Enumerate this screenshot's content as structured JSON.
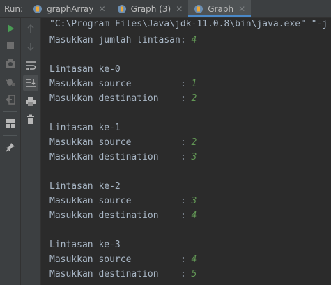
{
  "run_label": "Run:",
  "tabs": [
    {
      "label": "graphArray",
      "active": false
    },
    {
      "label": "Graph (3)",
      "active": false
    },
    {
      "label": "Graph",
      "active": true
    }
  ],
  "console": {
    "command": "\"C:\\Program Files\\Java\\jdk-11.0.8\\bin\\java.exe\" \"-j",
    "jumlah_prompt": "Masukkan jumlah lintasan: ",
    "jumlah_value": "4",
    "blocks": [
      {
        "title": "Lintasan ke-0",
        "source_prompt": "Masukkan source         : ",
        "source": "1",
        "dest_prompt": "Masukkan destination    : ",
        "dest": "2"
      },
      {
        "title": "Lintasan ke-1",
        "source_prompt": "Masukkan source         : ",
        "source": "2",
        "dest_prompt": "Masukkan destination    : ",
        "dest": "3"
      },
      {
        "title": "Lintasan ke-2",
        "source_prompt": "Masukkan source         : ",
        "source": "3",
        "dest_prompt": "Masukkan destination    : ",
        "dest": "4"
      },
      {
        "title": "Lintasan ke-3",
        "source_prompt": "Masukkan source         : ",
        "source": "4",
        "dest_prompt": "Masukkan destination    : ",
        "dest": "5"
      }
    ]
  },
  "toolbar_left": [
    "run-icon",
    "stop-icon",
    "camera-icon",
    "debug-bug-icon",
    "exit-icon",
    "layout-icon",
    "pin-icon"
  ],
  "toolbar_right": [
    "arrow-up-icon",
    "arrow-down-icon",
    "soft-wrap-icon",
    "scroll-to-end-icon",
    "print-icon",
    "trash-icon"
  ],
  "colors": {
    "background": "#2b2b2b",
    "panel": "#3c3f41",
    "console_text": "#a9b7c6",
    "user_input": "#629755",
    "run_green": "#499c54",
    "active_tab_underline": "#4a88c7"
  }
}
